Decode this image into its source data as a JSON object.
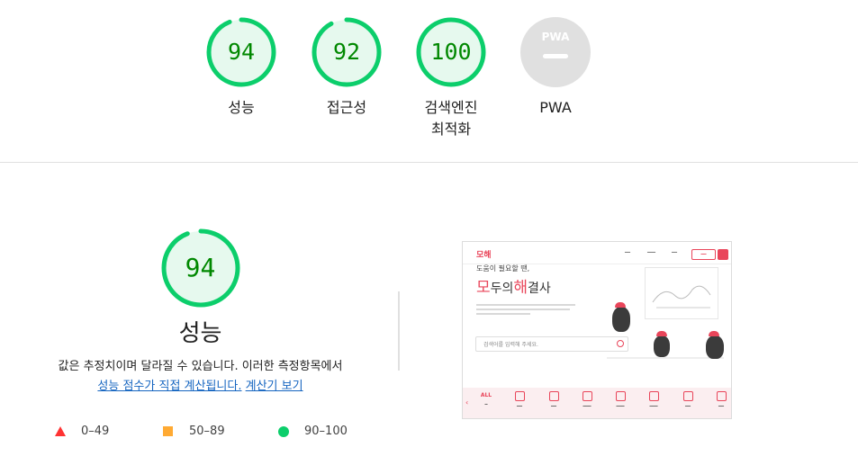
{
  "top_gauges": [
    {
      "score": "94",
      "label": "성능",
      "value": 94
    },
    {
      "score": "92",
      "label": "접근성",
      "value": 92
    },
    {
      "score": "100",
      "label": "검색엔진\n최적화",
      "label_line1": "검색엔진",
      "label_line2": "최적화",
      "value": 100
    },
    {
      "label": "PWA",
      "badge": "PWA"
    }
  ],
  "performance": {
    "score": "94",
    "value": 94,
    "title": "성능",
    "desc_line1": "값은 추정치이며 달라질 수 있습니다. 이러한 측정항목에서",
    "desc_link1": "성능 점수가 직접 계산됩니다.",
    "desc_link2": "계산기 보기"
  },
  "legend": [
    {
      "icon": "triangle",
      "range": "0–49",
      "color": "#ff3333"
    },
    {
      "icon": "square",
      "range": "50–89",
      "color": "#ffaa33"
    },
    {
      "icon": "circle",
      "range": "90–100",
      "color": "#0cce6b"
    }
  ],
  "colors": {
    "pass_green": "#0cce6b",
    "pass_text": "#008800",
    "pass_bg": "#e6f9ee",
    "link": "#1565c0",
    "brand_red": "#e9455a"
  },
  "screenshot": {
    "tagline": "도움이 필요할 땐,",
    "hero_a": "모",
    "hero_b": "두의",
    "hero_c": "해",
    "hero_d": "결사",
    "search_placeholder": "검색어를 입력해 주세요.",
    "category_all": "ALL"
  }
}
